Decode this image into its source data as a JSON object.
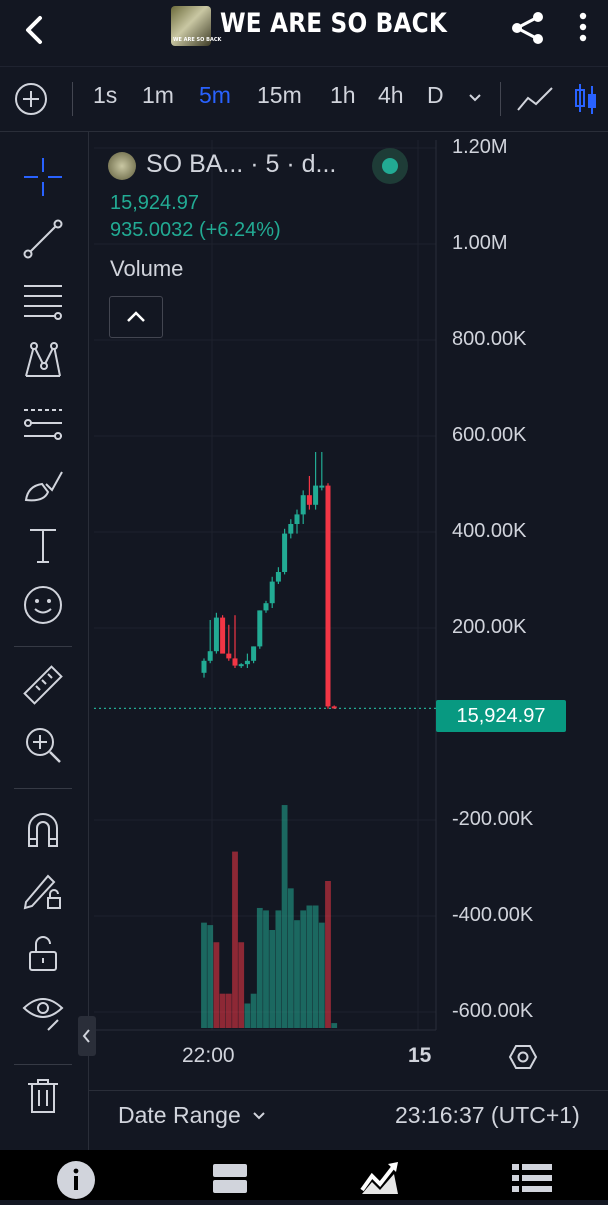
{
  "header": {
    "title": "WE ARE SO BACK",
    "logo_text": "WE ARE SO BACK",
    "back_icon": "chevron-left-icon",
    "share_icon": "share-icon",
    "more_icon": "more-vertical-icon"
  },
  "intervals": {
    "add_icon": "plus-circle-icon",
    "items": [
      "1s",
      "1m",
      "5m",
      "15m",
      "1h",
      "4h",
      "D"
    ],
    "active": "5m",
    "dropdown_icon": "chevron-down-icon",
    "chart_type_icons": [
      "line-chart-icon",
      "candlestick-icon"
    ]
  },
  "toolbar": {
    "tools": [
      "crosshair-icon",
      "trendline-icon",
      "fib-retracement-icon",
      "pattern-icon",
      "prediction-icon",
      "brush-icon",
      "text-icon",
      "emoji-icon",
      "ruler-icon",
      "zoom-in-icon",
      "magnet-icon",
      "lock-drawing-icon",
      "unlock-icon",
      "eye-icon",
      "trash-icon"
    ]
  },
  "legend": {
    "name": "SO BA... · 5 · d...",
    "price": "15,924.97",
    "change": "935.0032 (+6.24%)",
    "volume_label": "Volume"
  },
  "price_axis": {
    "labels": [
      "1.20M",
      "1.00M",
      "800.00K",
      "600.00K",
      "400.00K",
      "200.00K",
      "-200.00K",
      "-400.00K",
      "-600.00K"
    ],
    "current_price": "15,924.97"
  },
  "time_axis": {
    "labels": [
      "22:00",
      "15"
    ]
  },
  "footer": {
    "date_range": "Date Range",
    "clock": "23:16:37 (UTC+1)"
  },
  "colors": {
    "up": "#22ab94",
    "down": "#f23645",
    "accent": "#2962ff",
    "background": "#131722"
  },
  "bottom_nav": [
    "info-icon",
    "layout-icon",
    "chart-icon",
    "list-icon"
  ],
  "chart_data": {
    "type": "candlestick",
    "y_unit": "market cap",
    "ylim": [
      -650000,
      1250000
    ],
    "candles": [
      {
        "o": 90000,
        "h": 120000,
        "l": 80000,
        "c": 115000
      },
      {
        "o": 115000,
        "h": 200000,
        "l": 110000,
        "c": 135000
      },
      {
        "o": 135000,
        "h": 215000,
        "l": 130000,
        "c": 205000
      },
      {
        "o": 205000,
        "h": 210000,
        "l": 150000,
        "c": 130000
      },
      {
        "o": 130000,
        "h": 190000,
        "l": 115000,
        "c": 120000
      },
      {
        "o": 120000,
        "h": 210000,
        "l": 100000,
        "c": 105000
      },
      {
        "o": 105000,
        "h": 110000,
        "l": 100000,
        "c": 108000
      },
      {
        "o": 108000,
        "h": 130000,
        "l": 100000,
        "c": 115000
      },
      {
        "o": 115000,
        "h": 145000,
        "l": 110000,
        "c": 145000
      },
      {
        "o": 145000,
        "h": 220000,
        "l": 140000,
        "c": 220000
      },
      {
        "o": 220000,
        "h": 240000,
        "l": 215000,
        "c": 235000
      },
      {
        "o": 235000,
        "h": 290000,
        "l": 225000,
        "c": 280000
      },
      {
        "o": 280000,
        "h": 310000,
        "l": 275000,
        "c": 300000
      },
      {
        "o": 300000,
        "h": 390000,
        "l": 295000,
        "c": 380000
      },
      {
        "o": 380000,
        "h": 410000,
        "l": 370000,
        "c": 400000
      },
      {
        "o": 400000,
        "h": 430000,
        "l": 380000,
        "c": 420000
      },
      {
        "o": 420000,
        "h": 470000,
        "l": 400000,
        "c": 460000
      },
      {
        "o": 460000,
        "h": 500000,
        "l": 430000,
        "c": 440000
      },
      {
        "o": 440000,
        "h": 550000,
        "l": 430000,
        "c": 480000
      },
      {
        "o": 480000,
        "h": 550000,
        "l": 470000,
        "c": 480000
      },
      {
        "o": 480000,
        "h": 485000,
        "l": 15000,
        "c": 20000
      },
      {
        "o": 20000,
        "h": 22000,
        "l": 15000,
        "c": 15925
      }
    ],
    "volume": [
      {
        "v": 0.43,
        "up": true
      },
      {
        "v": 0.42,
        "up": true
      },
      {
        "v": 0.35,
        "up": false
      },
      {
        "v": 0.14,
        "up": false
      },
      {
        "v": 0.14,
        "up": false
      },
      {
        "v": 0.72,
        "up": false
      },
      {
        "v": 0.35,
        "up": false
      },
      {
        "v": 0.1,
        "up": true
      },
      {
        "v": 0.14,
        "up": true
      },
      {
        "v": 0.49,
        "up": true
      },
      {
        "v": 0.48,
        "up": true
      },
      {
        "v": 0.4,
        "up": true
      },
      {
        "v": 0.48,
        "up": true
      },
      {
        "v": 0.91,
        "up": true
      },
      {
        "v": 0.57,
        "up": true
      },
      {
        "v": 0.44,
        "up": true
      },
      {
        "v": 0.48,
        "up": true
      },
      {
        "v": 0.5,
        "up": true
      },
      {
        "v": 0.5,
        "up": true
      },
      {
        "v": 0.43,
        "up": true
      },
      {
        "v": 0.6,
        "up": false
      },
      {
        "v": 0.02,
        "up": true
      }
    ]
  }
}
